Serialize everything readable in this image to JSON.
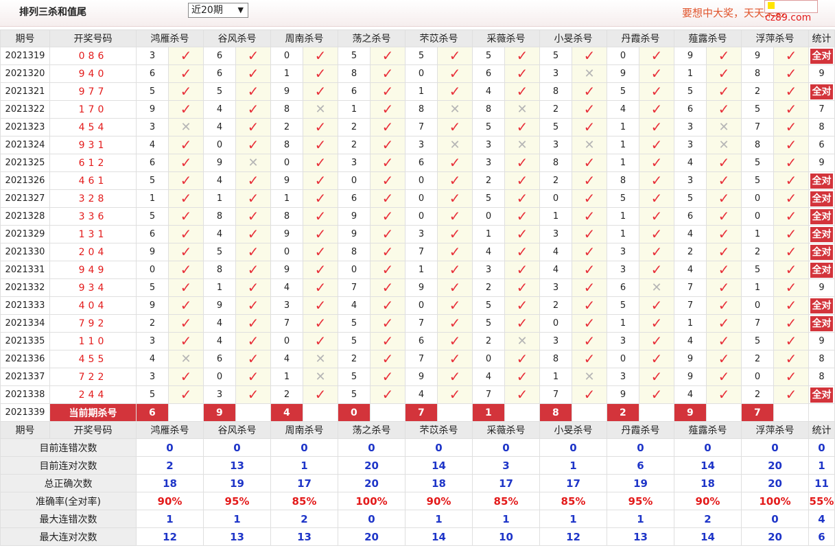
{
  "header": {
    "title": "排列三杀和值尾",
    "period_select": "近20期",
    "slogan": "要想中大奖，天天来彩",
    "logo_text": "cz89.com"
  },
  "columns": {
    "issue": "期号",
    "numbers": "开奖号码",
    "experts": [
      "鸿雁杀号",
      "谷风杀号",
      "周南杀号",
      "荡之杀号",
      "芣苡杀号",
      "采薇杀号",
      "小旻杀号",
      "丹霞杀号",
      "薤露杀号",
      "浮萍杀号"
    ],
    "stat": "统计"
  },
  "rows": [
    {
      "issue": "2021319",
      "numbers": "086",
      "kills": [
        3,
        6,
        0,
        5,
        5,
        5,
        5,
        0,
        9,
        9
      ],
      "hits": [
        1,
        1,
        1,
        1,
        1,
        1,
        1,
        1,
        1,
        1
      ],
      "stat": "全对"
    },
    {
      "issue": "2021320",
      "numbers": "940",
      "kills": [
        6,
        6,
        1,
        8,
        0,
        6,
        3,
        9,
        1,
        8
      ],
      "hits": [
        1,
        1,
        1,
        1,
        1,
        1,
        0,
        1,
        1,
        1
      ],
      "stat": "9"
    },
    {
      "issue": "2021321",
      "numbers": "977",
      "kills": [
        5,
        5,
        9,
        6,
        1,
        4,
        8,
        5,
        5,
        2
      ],
      "hits": [
        1,
        1,
        1,
        1,
        1,
        1,
        1,
        1,
        1,
        1
      ],
      "stat": "全对"
    },
    {
      "issue": "2021322",
      "numbers": "170",
      "kills": [
        9,
        4,
        8,
        1,
        8,
        8,
        2,
        4,
        6,
        5
      ],
      "hits": [
        1,
        1,
        0,
        1,
        0,
        0,
        1,
        1,
        1,
        1
      ],
      "stat": "7"
    },
    {
      "issue": "2021323",
      "numbers": "454",
      "kills": [
        3,
        4,
        2,
        2,
        7,
        5,
        5,
        1,
        3,
        7
      ],
      "hits": [
        0,
        1,
        1,
        1,
        1,
        1,
        1,
        1,
        0,
        1
      ],
      "stat": "8"
    },
    {
      "issue": "2021324",
      "numbers": "931",
      "kills": [
        4,
        0,
        8,
        2,
        3,
        3,
        3,
        1,
        3,
        8
      ],
      "hits": [
        1,
        1,
        1,
        1,
        0,
        0,
        0,
        1,
        0,
        1
      ],
      "stat": "6"
    },
    {
      "issue": "2021325",
      "numbers": "612",
      "kills": [
        6,
        9,
        0,
        3,
        6,
        3,
        8,
        1,
        4,
        5
      ],
      "hits": [
        1,
        0,
        1,
        1,
        1,
        1,
        1,
        1,
        1,
        1
      ],
      "stat": "9"
    },
    {
      "issue": "2021326",
      "numbers": "461",
      "kills": [
        5,
        4,
        9,
        0,
        0,
        2,
        2,
        8,
        3,
        5
      ],
      "hits": [
        1,
        1,
        1,
        1,
        1,
        1,
        1,
        1,
        1,
        1
      ],
      "stat": "全对"
    },
    {
      "issue": "2021327",
      "numbers": "328",
      "kills": [
        1,
        1,
        1,
        6,
        0,
        5,
        0,
        5,
        5,
        0
      ],
      "hits": [
        1,
        1,
        1,
        1,
        1,
        1,
        1,
        1,
        1,
        1
      ],
      "stat": "全对"
    },
    {
      "issue": "2021328",
      "numbers": "336",
      "kills": [
        5,
        8,
        8,
        9,
        0,
        0,
        1,
        1,
        6,
        0
      ],
      "hits": [
        1,
        1,
        1,
        1,
        1,
        1,
        1,
        1,
        1,
        1
      ],
      "stat": "全对"
    },
    {
      "issue": "2021329",
      "numbers": "131",
      "kills": [
        6,
        4,
        9,
        9,
        3,
        1,
        3,
        1,
        4,
        1
      ],
      "hits": [
        1,
        1,
        1,
        1,
        1,
        1,
        1,
        1,
        1,
        1
      ],
      "stat": "全对"
    },
    {
      "issue": "2021330",
      "numbers": "204",
      "kills": [
        9,
        5,
        0,
        8,
        7,
        4,
        4,
        3,
        2,
        2
      ],
      "hits": [
        1,
        1,
        1,
        1,
        1,
        1,
        1,
        1,
        1,
        1
      ],
      "stat": "全对"
    },
    {
      "issue": "2021331",
      "numbers": "949",
      "kills": [
        0,
        8,
        9,
        0,
        1,
        3,
        4,
        3,
        4,
        5
      ],
      "hits": [
        1,
        1,
        1,
        1,
        1,
        1,
        1,
        1,
        1,
        1
      ],
      "stat": "全对"
    },
    {
      "issue": "2021332",
      "numbers": "934",
      "kills": [
        5,
        1,
        4,
        7,
        9,
        2,
        3,
        6,
        7,
        1
      ],
      "hits": [
        1,
        1,
        1,
        1,
        1,
        1,
        1,
        0,
        1,
        1
      ],
      "stat": "9"
    },
    {
      "issue": "2021333",
      "numbers": "404",
      "kills": [
        9,
        9,
        3,
        4,
        0,
        5,
        2,
        5,
        7,
        0
      ],
      "hits": [
        1,
        1,
        1,
        1,
        1,
        1,
        1,
        1,
        1,
        1
      ],
      "stat": "全对"
    },
    {
      "issue": "2021334",
      "numbers": "792",
      "kills": [
        2,
        4,
        7,
        5,
        7,
        5,
        0,
        1,
        1,
        7
      ],
      "hits": [
        1,
        1,
        1,
        1,
        1,
        1,
        1,
        1,
        1,
        1
      ],
      "stat": "全对"
    },
    {
      "issue": "2021335",
      "numbers": "110",
      "kills": [
        3,
        4,
        0,
        5,
        6,
        2,
        3,
        3,
        4,
        5
      ],
      "hits": [
        1,
        1,
        1,
        1,
        1,
        0,
        1,
        1,
        1,
        1
      ],
      "stat": "9"
    },
    {
      "issue": "2021336",
      "numbers": "455",
      "kills": [
        4,
        6,
        4,
        2,
        7,
        0,
        8,
        0,
        9,
        2
      ],
      "hits": [
        0,
        1,
        0,
        1,
        1,
        1,
        1,
        1,
        1,
        1
      ],
      "stat": "8"
    },
    {
      "issue": "2021337",
      "numbers": "722",
      "kills": [
        3,
        0,
        1,
        5,
        9,
        4,
        1,
        3,
        9,
        0
      ],
      "hits": [
        1,
        1,
        0,
        1,
        1,
        1,
        0,
        1,
        1,
        1
      ],
      "stat": "8"
    },
    {
      "issue": "2021338",
      "numbers": "244",
      "kills": [
        5,
        3,
        2,
        5,
        4,
        7,
        7,
        9,
        4,
        2
      ],
      "hits": [
        1,
        1,
        1,
        1,
        1,
        1,
        1,
        1,
        1,
        1
      ],
      "stat": "全对"
    }
  ],
  "current": {
    "issue": "2021339",
    "label": "当前期杀号",
    "kills": [
      6,
      9,
      4,
      0,
      7,
      1,
      8,
      2,
      9,
      7
    ]
  },
  "summary": [
    {
      "label": "目前连错次数",
      "values": [
        "0",
        "0",
        "0",
        "0",
        "0",
        "0",
        "0",
        "0",
        "0",
        "0"
      ],
      "stat": "0",
      "color": "blue"
    },
    {
      "label": "目前连对次数",
      "values": [
        "2",
        "13",
        "1",
        "20",
        "14",
        "3",
        "1",
        "6",
        "14",
        "20"
      ],
      "stat": "1",
      "color": "blue"
    },
    {
      "label": "总正确次数",
      "values": [
        "18",
        "19",
        "17",
        "20",
        "18",
        "17",
        "17",
        "19",
        "18",
        "20"
      ],
      "stat": "11",
      "color": "blue"
    },
    {
      "label": "准确率(全对率)",
      "values": [
        "90%",
        "95%",
        "85%",
        "100%",
        "90%",
        "85%",
        "85%",
        "95%",
        "90%",
        "100%"
      ],
      "stat": "55%",
      "color": "red"
    },
    {
      "label": "最大连错次数",
      "values": [
        "1",
        "1",
        "2",
        "0",
        "1",
        "1",
        "1",
        "1",
        "2",
        "0"
      ],
      "stat": "4",
      "color": "blue"
    },
    {
      "label": "最大连对次数",
      "values": [
        "12",
        "13",
        "13",
        "20",
        "14",
        "10",
        "12",
        "13",
        "14",
        "20"
      ],
      "stat": "6",
      "color": "blue"
    }
  ],
  "icons": {
    "hit": "check-icon",
    "miss": "cross-icon",
    "check_color": "#e8303a",
    "cross_color": "#b5b5b5",
    "accent": "#d3343b"
  }
}
